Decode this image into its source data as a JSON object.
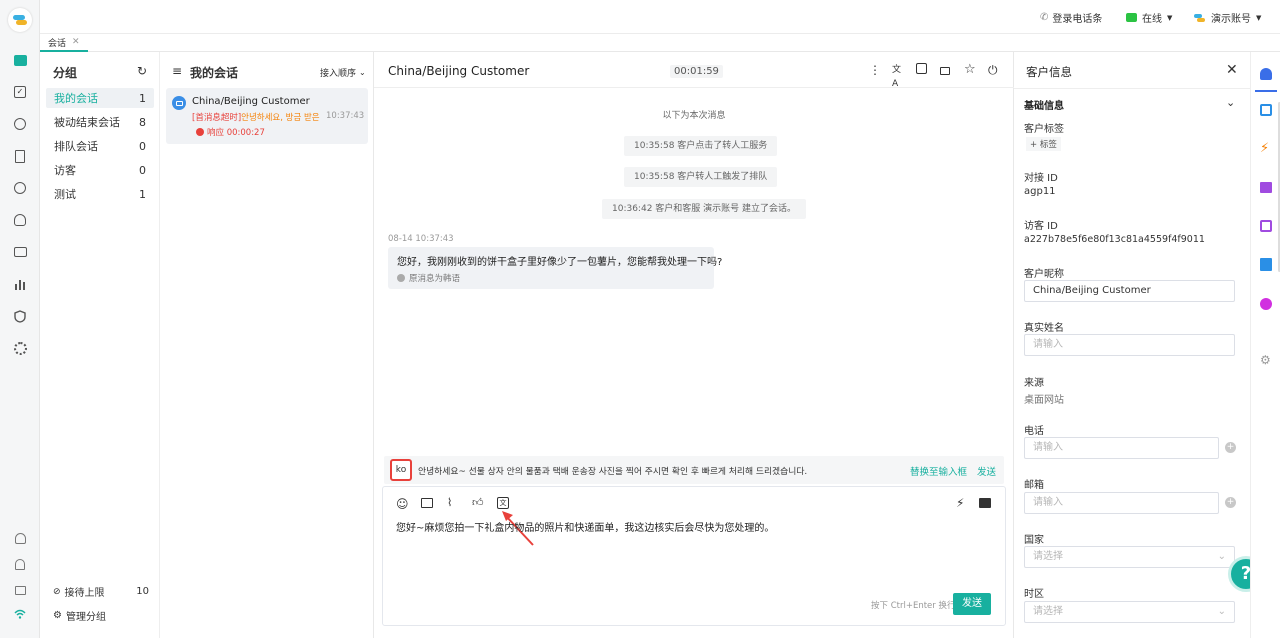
{
  "topbar": {
    "phone_login": "登录电话条",
    "status": "在线",
    "account": "演示账号"
  },
  "tabs": [
    {
      "label": "会话"
    }
  ],
  "groups": {
    "title": "分组",
    "items": [
      {
        "label": "我的会话",
        "count": "1"
      },
      {
        "label": "被动结束会话",
        "count": "8"
      },
      {
        "label": "排队会话",
        "count": "0"
      },
      {
        "label": "访客",
        "count": "0"
      },
      {
        "label": "测试",
        "count": "1"
      }
    ],
    "limit_label": "接待上限",
    "limit_value": "10",
    "manage_label": "管理分组"
  },
  "conversations": {
    "title": "我的会话",
    "sort_label": "接入顺序",
    "items": [
      {
        "name": "China/Beijing Customer",
        "tag": "[首消息超时]",
        "preview": "안녕하세요, 방금 받은 ...",
        "time": "10:37:43",
        "response": "响应 00:00:27"
      }
    ]
  },
  "chat": {
    "title": "China/Beijing Customer",
    "timer": "00:01:59",
    "divider": "以下为本次消息",
    "system_messages": [
      "10:35:58 客户点击了转人工服务",
      "10:35:58 客户转人工触发了排队",
      "10:36:42 客户和客服 演示账号 建立了会话。"
    ],
    "message_time": "08-14 10:37:43",
    "message_text": "您好，我刚刚收到的饼干盒子里好像少了一包薯片，您能帮我处理一下吗?",
    "translation_note": "原消息为韩语",
    "translation": {
      "lang": "ko",
      "text": "안녕하세요~ 선물 상자 안의 물품과 택배 운송장 사진을 찍어 주시면 확인 후 빠르게 처리해 드리겠습니다.",
      "replace_label": "替换至输入框",
      "send_label": "发送"
    },
    "input_text": "您好~麻烦您拍一下礼盒内物品的照片和快递面单，我这边核实后会尽快为您处理的。",
    "hint": "按下 Ctrl+Enter 换行",
    "send_button": "发送"
  },
  "info": {
    "title": "客户信息",
    "section": "基础信息",
    "tags_label": "客户标签",
    "add_tag": "+ 标签",
    "connect_id_label": "对接 ID",
    "connect_id": "agp11",
    "visitor_id_label": "访客 ID",
    "visitor_id": "a227b78e5f6e80f13c81a4559f4f9011",
    "nickname_label": "客户昵称",
    "nickname": "China/Beijing Customer",
    "realname_label": "真实姓名",
    "realname_placeholder": "请输入",
    "source_label": "来源",
    "source": "桌面网站",
    "phone_label": "电话",
    "phone_placeholder": "请输入",
    "email_label": "邮箱",
    "email_placeholder": "请输入",
    "country_label": "国家",
    "country_placeholder": "请选择",
    "timezone_label": "时区",
    "timezone_placeholder": "请选择"
  },
  "colors": {
    "accent": "#18b09f",
    "danger": "#e8413b",
    "orange": "#f5830a"
  }
}
